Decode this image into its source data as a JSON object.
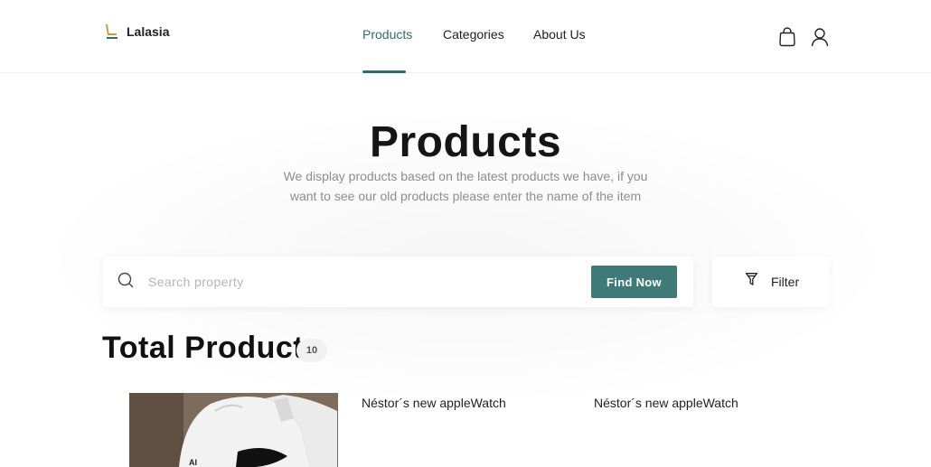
{
  "brand": {
    "name": "Lalasia",
    "logo_icon": "chair-logo-icon"
  },
  "nav": {
    "items": [
      {
        "label": "Products",
        "active": true
      },
      {
        "label": "Categories",
        "active": false
      },
      {
        "label": "About Us",
        "active": false
      }
    ],
    "accent_color": "#2e6b6b"
  },
  "header_icons": {
    "cart": "bag-icon",
    "profile": "user-icon"
  },
  "hero": {
    "title": "Products",
    "description": "We display products based on the latest products we have, if you want to see our old products please enter the name of the item"
  },
  "search": {
    "placeholder": "Search property",
    "value": "",
    "button_label": "Find Now",
    "button_color": "#3f7a78"
  },
  "filter": {
    "label": "Filter",
    "icon": "filter-icon"
  },
  "products_summary": {
    "title": "Total Products",
    "count": "10"
  },
  "products": [
    {
      "name": "Néstor´s new appleWatch",
      "image": "sneaker-photo"
    },
    {
      "name": "Néstor´s new appleWatch"
    },
    {
      "name": "Néstor´s new appleWatch"
    }
  ]
}
